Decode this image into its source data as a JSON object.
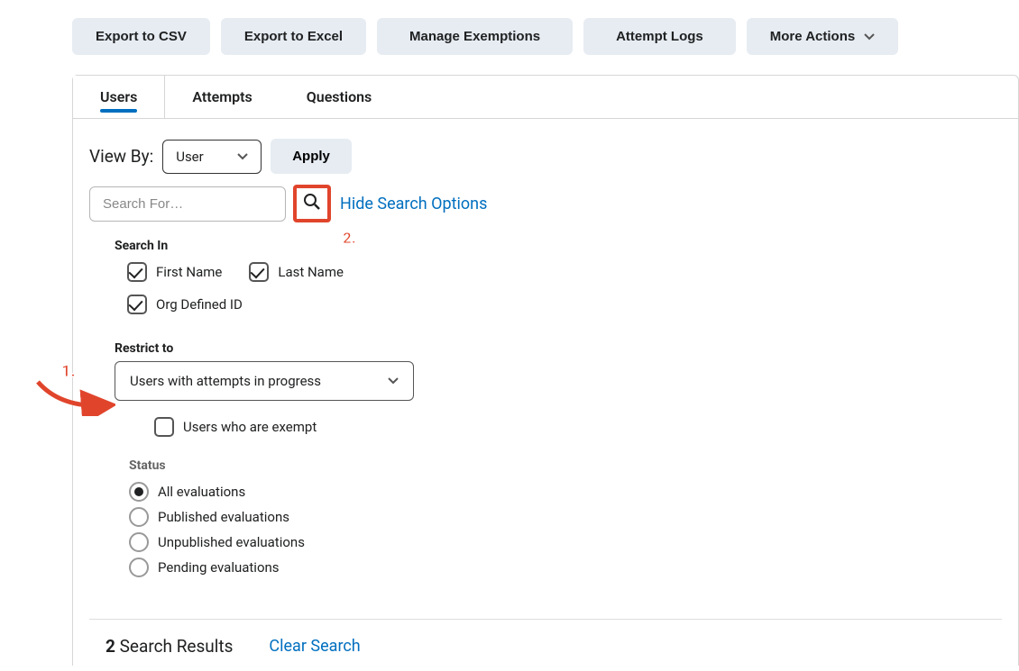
{
  "toolbar": {
    "export_csv": "Export to CSV",
    "export_excel": "Export to Excel",
    "manage_exemptions": "Manage Exemptions",
    "attempt_logs": "Attempt Logs",
    "more_actions": "More Actions"
  },
  "tabs": {
    "users": "Users",
    "attempts": "Attempts",
    "questions": "Questions"
  },
  "viewby": {
    "label": "View By:",
    "selected": "User",
    "apply": "Apply"
  },
  "search": {
    "placeholder": "Search For…",
    "hide_options": "Hide Search Options"
  },
  "search_in": {
    "label": "Search In",
    "first_name": "First Name",
    "last_name": "Last Name",
    "org_id": "Org Defined ID"
  },
  "restrict": {
    "label": "Restrict to",
    "selected": "Users with attempts in progress",
    "exempt": "Users who are exempt"
  },
  "status": {
    "label": "Status",
    "all": "All evaluations",
    "published": "Published evaluations",
    "unpublished": "Unpublished evaluations",
    "pending": "Pending evaluations"
  },
  "results": {
    "count": "2",
    "label": "Search Results",
    "clear": "Clear Search"
  },
  "annot": {
    "one": "1.",
    "two": "2."
  }
}
